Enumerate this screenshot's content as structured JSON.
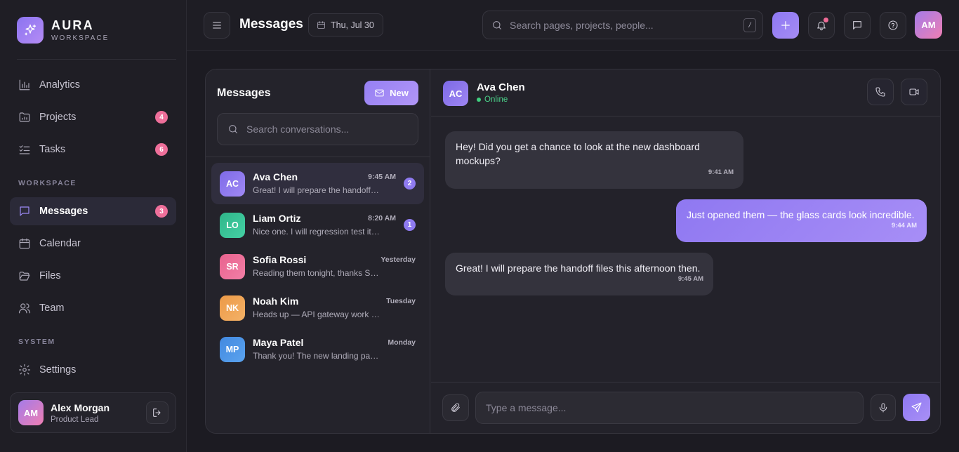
{
  "colors": {
    "accent": "#9480f3",
    "badge_pink": "#ee6f9a",
    "online_green": "#4bd28a",
    "background": "#1c1b22"
  },
  "brand": {
    "name": "AURA",
    "subtitle": "WORKSPACE",
    "icon": "sparkles-icon"
  },
  "sidebar": {
    "main_items": [
      {
        "label": "Analytics",
        "icon": "bar-chart-icon",
        "badge": ""
      },
      {
        "label": "Projects",
        "icon": "folder-icon",
        "badge": "4"
      },
      {
        "label": "Tasks",
        "icon": "checklist-icon",
        "badge": "6"
      }
    ],
    "workspace_label": "WORKSPACE",
    "workspace_items": [
      {
        "label": "Messages",
        "icon": "message-icon",
        "badge": "3",
        "active": true
      },
      {
        "label": "Calendar",
        "icon": "calendar-icon",
        "badge": ""
      },
      {
        "label": "Files",
        "icon": "folder-open-icon",
        "badge": ""
      },
      {
        "label": "Team",
        "icon": "users-icon",
        "badge": ""
      }
    ],
    "system_label": "SYSTEM",
    "system_items": [
      {
        "label": "Settings",
        "icon": "gear-icon",
        "badge": ""
      }
    ],
    "user": {
      "initials": "AM",
      "name": "Alex Morgan",
      "role": "Product Lead"
    }
  },
  "header": {
    "title": "Messages",
    "date": "Thu, Jul 30",
    "search_placeholder": "Search pages, projects, people...",
    "search_shortcut": "/",
    "avatar_initials": "AM"
  },
  "conversations": {
    "title": "Messages",
    "new_label": "New",
    "search_placeholder": "Search conversations...",
    "items": [
      {
        "initials": "AC",
        "name": "Ava Chen",
        "time": "9:45 AM",
        "preview": "Great! I will prepare the handoff files this afternoon then.",
        "unread": "2",
        "color": "#8b74ee",
        "active": true
      },
      {
        "initials": "LO",
        "name": "Liam Ortiz",
        "time": "8:20 AM",
        "preview": "Nice one. I will regression test it today.",
        "unread": "1",
        "color": "#34c194"
      },
      {
        "initials": "SR",
        "name": "Sofia Rossi",
        "time": "Yesterday",
        "preview": "Reading them tonight, thanks Sofia!",
        "unread": "",
        "color": "#ec6c97"
      },
      {
        "initials": "NK",
        "name": "Noah Kim",
        "time": "Tuesday",
        "preview": "Heads up — API gateway work is scheduled.",
        "unread": "",
        "color": "#f0a555"
      },
      {
        "initials": "MP",
        "name": "Maya Patel",
        "time": "Monday",
        "preview": "Thank you! The new landing page is live.",
        "unread": "",
        "color": "#4e95e6"
      }
    ]
  },
  "chat": {
    "contact_initials": "AC",
    "contact_name": "Ava Chen",
    "status": "Online",
    "messages": [
      {
        "dir": "in",
        "text": "Hey! Did you get a chance to look at the new dashboard mockups?",
        "time": "9:41 AM"
      },
      {
        "dir": "out",
        "text": "Just opened them — the glass cards look incredible.",
        "time": "9:44 AM"
      },
      {
        "dir": "in",
        "text": "Great! I will prepare the handoff files this afternoon then.",
        "time": "9:45 AM"
      }
    ],
    "composer_placeholder": "Type a message..."
  }
}
